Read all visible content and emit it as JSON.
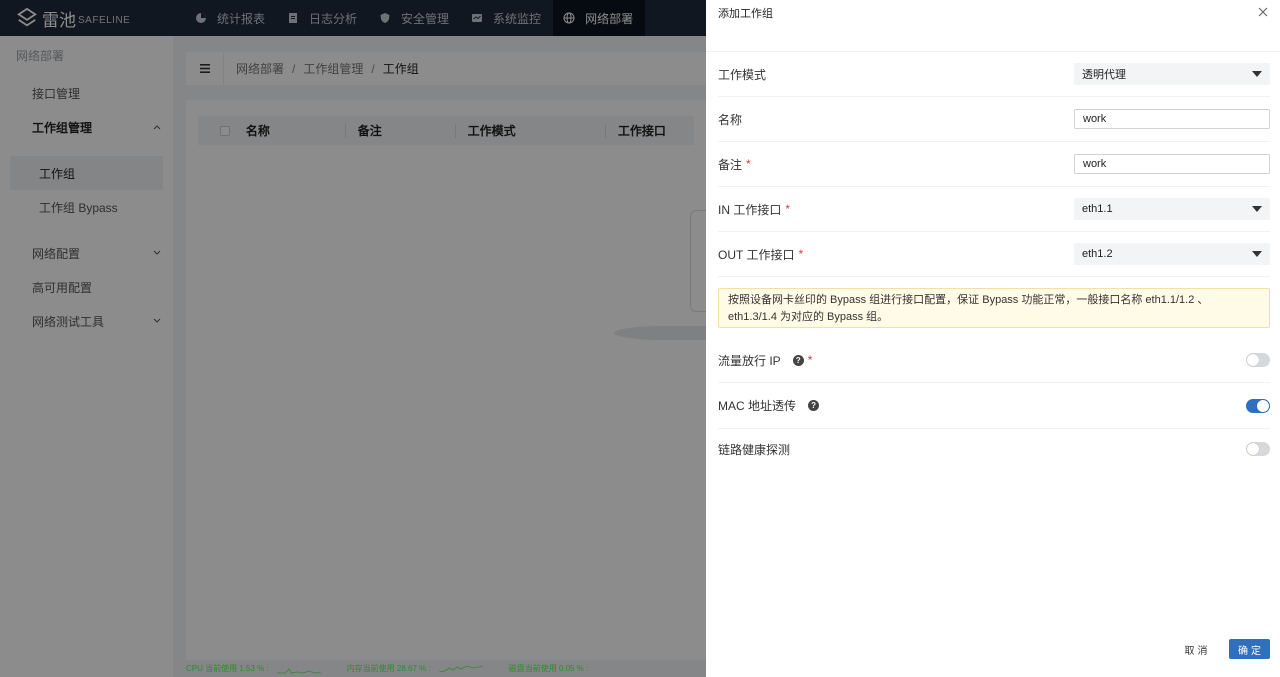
{
  "brand": {
    "name": "雷池",
    "name_en": "SAFELINE",
    "icon": "safeline-logo-icon"
  },
  "topnav": [
    {
      "label": "统计报表",
      "icon": "pie-chart-icon"
    },
    {
      "label": "日志分析",
      "icon": "document-icon"
    },
    {
      "label": "安全管理",
      "icon": "shield-icon"
    },
    {
      "label": "系统监控",
      "icon": "monitor-icon"
    },
    {
      "label": "网络部署",
      "icon": "globe-icon",
      "active": true
    }
  ],
  "sidebar": {
    "title": "网络部署",
    "items": [
      {
        "label": "接口管理"
      },
      {
        "label": "工作组管理"
      },
      {
        "label": "工作组"
      },
      {
        "label": "工作组 Bypass"
      },
      {
        "label": "网络配置"
      },
      {
        "label": "高可用配置"
      },
      {
        "label": "网络测试工具"
      }
    ]
  },
  "breadcrumb": {
    "parts": [
      "网络部署",
      "工作组管理",
      "工作组"
    ],
    "separator": "/"
  },
  "table": {
    "columns": [
      "名称",
      "备注",
      "工作模式",
      "工作接口"
    ]
  },
  "statusbar": {
    "cpu": "CPU 当前使用 1.53 % :",
    "mem": "内存当前使用 28.67 % :",
    "disk": "磁盘当前使用 0.05 % :"
  },
  "drawer": {
    "title": "添加工作组",
    "fields": {
      "mode": {
        "label": "工作模式",
        "value": "透明代理"
      },
      "name": {
        "label": "名称",
        "value": "work"
      },
      "remark": {
        "label": "备注",
        "value": "work"
      },
      "in_iface": {
        "label": "IN 工作接口",
        "value": "eth1.1"
      },
      "out_iface": {
        "label": "OUT 工作接口",
        "value": "eth1.2"
      }
    },
    "notice_line1": "按照设备网卡丝印的 Bypass 组进行接口配置，保证 Bypass 功能正常，一般接口名称 eth1.1/1.2 、",
    "notice_line2": "eth1.3/1.4 为对应的 Bypass 组。",
    "required_mark": "*",
    "toggles": {
      "traffic_ip": {
        "label": "流量放行 IP",
        "on": false
      },
      "mac": {
        "label": "MAC 地址透传",
        "on": true
      },
      "health": {
        "label": "链路健康探测",
        "on": false
      }
    },
    "cancel_label": "取消",
    "ok_label": "确定"
  },
  "colors": {
    "nav_bg": "#1f2a3c",
    "primary": "#2f6fbf",
    "required": "#d9363e",
    "notice_bg": "#fffbe6"
  }
}
